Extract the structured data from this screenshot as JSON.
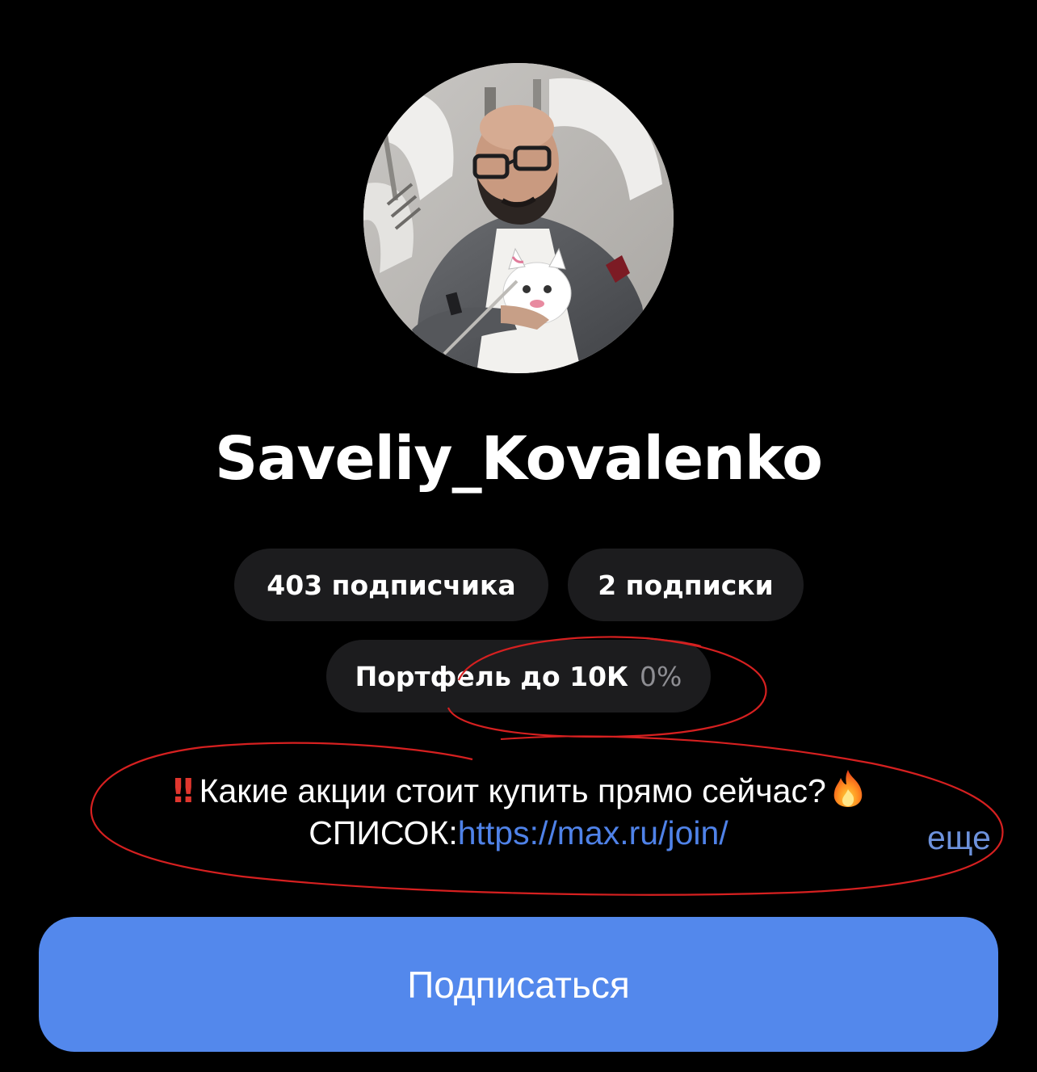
{
  "profile": {
    "username": "Saveliy_Kovalenko",
    "avatar_alt": "avatar"
  },
  "stats": {
    "followers_label": "403 подписчика",
    "subscriptions_label": "2 подписки"
  },
  "portfolio": {
    "label": "Портфель до 10К",
    "change": "0%"
  },
  "bio": {
    "prefix_icon": "double-exclamation-icon",
    "line1_text": "Какие акции стоит купить прямо сейчас?",
    "suffix_icon": "fire-icon",
    "line2_prefix": "СПИСОК:",
    "link": "https://max.ru/join/",
    "more_label": "еще"
  },
  "actions": {
    "subscribe_label": "Подписаться"
  },
  "colors": {
    "background": "#000000",
    "pill": "#1c1c1e",
    "link": "#4f82e8",
    "button": "#5388ec",
    "annotation": "#d62020"
  }
}
